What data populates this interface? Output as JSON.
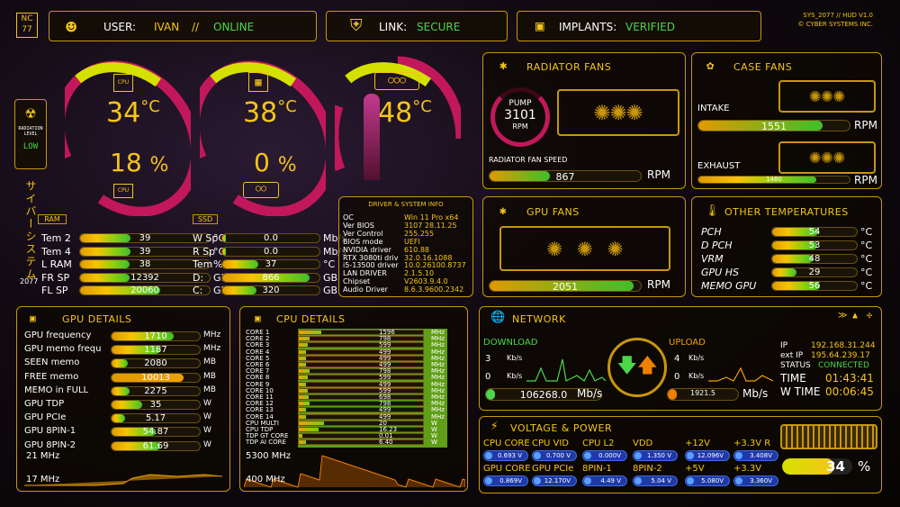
{
  "header": {
    "logo": "NC\n77",
    "user_label": "USER:",
    "user_name": "IVAN",
    "user_sep": "//",
    "user_status": "ONLINE",
    "link_label": "LINK:",
    "link_value": "SECURE",
    "implants_label": "IMPLANTS:",
    "implants_value": "VERIFIED",
    "sys_line1": "SYS_2077 // HUD V1.0",
    "sys_line2": "© CYBER SYSTEMS INC."
  },
  "radiation": {
    "label1": "RADIATION",
    "label2": "LEVEL",
    "value": "LOW"
  },
  "side_text": "サイバーシステム",
  "side_year": "2077",
  "gauges": [
    {
      "temp": "34",
      "unit": "°C",
      "load": "18",
      "load_unit": "%",
      "chip": "CPU",
      "level": 0.18
    },
    {
      "temp": "38",
      "unit": "°C",
      "load": "0",
      "load_unit": "%",
      "chip": "GPU",
      "level": 0.0
    },
    {
      "temp": "48",
      "unit": "°C",
      "chip": "GPU",
      "level": 0.48
    }
  ],
  "ram_tag": "RAM",
  "ssd_tag": "SSD",
  "ram_rows": [
    {
      "label": "Tem 2",
      "value": "39",
      "unit": "°C",
      "level": 0.39
    },
    {
      "label": "Tem 4",
      "value": "39",
      "unit": "°C",
      "level": 0.39
    },
    {
      "label": "L RAM",
      "value": "38",
      "unit": "%",
      "level": 0.38
    },
    {
      "label": "FR SP",
      "value": "12392",
      "unit": "GB",
      "level": 0.38
    },
    {
      "label": "FL SP",
      "value": "20060",
      "unit": "GB",
      "level": 0.62
    }
  ],
  "ssd_rows": [
    {
      "label": "W Sp",
      "value": "0.0",
      "unit": "Mb/s",
      "level": 0.0
    },
    {
      "label": "R Sp",
      "value": "0.0",
      "unit": "Mb/s",
      "level": 0.0
    },
    {
      "label": "Tem",
      "value": "37",
      "unit": "°C",
      "level": 0.37
    },
    {
      "label": "D:",
      "value": "866",
      "unit": "GB",
      "level": 0.9
    },
    {
      "label": "C:",
      "value": "320",
      "unit": "GB",
      "level": 0.35
    }
  ],
  "driver": {
    "title": "DRIVER & SYSTEM INFO",
    "rows": [
      {
        "k": "OC",
        "v": "Win 11 Pro x64"
      },
      {
        "k": "Ver BIOS",
        "v": "3107  28.11.25"
      },
      {
        "k": "Ver Control",
        "v": "255.255"
      },
      {
        "k": "BIOS mode",
        "v": "UEFI"
      },
      {
        "k": "NVIDIA driver",
        "v": "610.88"
      },
      {
        "k": "RTX 3080ti driv",
        "v": "32.0.16.1088"
      },
      {
        "k": "i5-13500 driver",
        "v": "10.0.26100.8737"
      },
      {
        "k": "LAN DRIVER",
        "v": "2.1.5.10"
      },
      {
        "k": "Chipset",
        "v": "V2603.9.4.0"
      },
      {
        "k": "Audio Driver",
        "v": "8.6.3.9600.2342"
      }
    ]
  },
  "gpu_details": {
    "title": "GPU DETAILS",
    "rows": [
      {
        "label": "GPU frequency",
        "value": "1710",
        "unit": "MHz",
        "level": 0.7
      },
      {
        "label": "GPU memo frequ",
        "value": "1187",
        "unit": "MHz",
        "level": 0.55
      },
      {
        "label": "SEEN memo",
        "value": "2080",
        "unit": "MB",
        "level": 0.18
      },
      {
        "label": "FREE memo",
        "value": "10013",
        "unit": "MB",
        "level": 0.82
      },
      {
        "label": "MEMO in FULL",
        "value": "2275",
        "unit": "MB",
        "level": 0.2
      },
      {
        "label": "GPU     TDP",
        "value": "35",
        "unit": "W",
        "level": 0.35
      },
      {
        "label": "GPU    PCIe",
        "value": "5.17",
        "unit": "W",
        "level": 0.15
      },
      {
        "label": "GPU     8PIN-1",
        "value": "54.87",
        "unit": "W",
        "level": 0.5
      },
      {
        "label": "GPU     8PIN-2",
        "value": "61.69",
        "unit": "W",
        "level": 0.55
      }
    ],
    "graph_top": "21 MHz",
    "graph_bottom": "17 MHz"
  },
  "cpu_details": {
    "title": "CPU DETAILS",
    "rows": [
      {
        "label": "CORE 1",
        "value": "1596",
        "unit": "MHz",
        "level": 0.18
      },
      {
        "label": "CORE 2",
        "value": "798",
        "unit": "MHz",
        "level": 0.09
      },
      {
        "label": "CORE 3",
        "value": "599",
        "unit": "MHz",
        "level": 0.07
      },
      {
        "label": "CORE 4",
        "value": "499",
        "unit": "MHz",
        "level": 0.06
      },
      {
        "label": "CORE 5",
        "value": "499",
        "unit": "MHz",
        "level": 0.06
      },
      {
        "label": "CORE 6",
        "value": "499",
        "unit": "MHz",
        "level": 0.06
      },
      {
        "label": "CORE 7",
        "value": "798",
        "unit": "MHz",
        "level": 0.09
      },
      {
        "label": "CORE 8",
        "value": "599",
        "unit": "MHz",
        "level": 0.07
      },
      {
        "label": "CORE 9",
        "value": "499",
        "unit": "MHz",
        "level": 0.06
      },
      {
        "label": "CORE 10",
        "value": "599",
        "unit": "MHz",
        "level": 0.07
      },
      {
        "label": "CORE 11",
        "value": "698",
        "unit": "MHz",
        "level": 0.08
      },
      {
        "label": "CORE 12",
        "value": "798",
        "unit": "MHz",
        "level": 0.09
      },
      {
        "label": "CORE 13",
        "value": "499",
        "unit": "MHz",
        "level": 0.06
      },
      {
        "label": "CORE 14",
        "value": "499",
        "unit": "MHz",
        "level": 0.06
      },
      {
        "label": "CPU MULTI",
        "value": "20",
        "unit": "W",
        "level": 0.2
      },
      {
        "label": "CPU TDP",
        "value": "16.23",
        "unit": "W",
        "level": 0.16
      },
      {
        "label": "TDP GT CORE",
        "value": "0.01",
        "unit": "W",
        "level": 0.0
      },
      {
        "label": "TDP AI CORE",
        "value": "6.40",
        "unit": "W",
        "level": 0.06
      }
    ],
    "graph_top": "5300 MHz",
    "graph_bottom": "400  MHz"
  },
  "radiator": {
    "title": "RADIATOR FANS",
    "pump_label": "PUMP",
    "pump_value": "3101",
    "pump_unit": "RPM",
    "speed_label": "RADIATOR FAN SPEED",
    "speed_value": "867",
    "speed_unit": "RPM",
    "level": 0.4
  },
  "case_fans": {
    "title": "CASE FANS",
    "intake_label": "INTAKE",
    "intake_value": "1551",
    "intake_unit": "RPM",
    "intake_level": 0.82,
    "exhaust_label": "EXHAUST",
    "exhaust_value": "1480",
    "exhaust_unit": "RPM",
    "exhaust_level": 0.78
  },
  "gpu_fans": {
    "title": "GPU FANS",
    "value": "2051",
    "unit": "RPM",
    "level": 0.95
  },
  "other_temps": {
    "title": "OTHER TEMPERATURES",
    "rows": [
      {
        "label": "PCH",
        "value": "54",
        "unit": "°C",
        "level": 0.54
      },
      {
        "label": "D PCH",
        "value": "53",
        "unit": "°C",
        "level": 0.53
      },
      {
        "label": "VRM",
        "value": "48",
        "unit": "°C",
        "level": 0.48
      },
      {
        "label": "GPU HS",
        "value": "29",
        "unit": "°C",
        "level": 0.29
      },
      {
        "label": "MEMO GPU",
        "value": "56",
        "unit": "°C",
        "level": 0.56
      }
    ]
  },
  "network": {
    "title": "NETWORK",
    "download_label": "DOWNLOAD",
    "upload_label": "UPLOAD",
    "dl_axis_top": "3",
    "dl_axis_bottom": "0",
    "ul_axis_top": "4",
    "ul_axis_bottom": "0",
    "axis_unit": "Kb/s",
    "dl_value": "106268.0",
    "dl_unit": "Mb/s",
    "ul_value": "1921.5",
    "ul_unit": "Mb/s",
    "ip_label": "IP",
    "ip_value": "192.168.31.244",
    "ext_label": "ext IP",
    "ext_value": "195.64.239.17",
    "status_label": "STATUS",
    "status_value": "CONNECTED",
    "time_label": "TIME",
    "time_value": "01:43:41",
    "wtime_label": "W TIME",
    "wtime_value": "00:06:45"
  },
  "voltage": {
    "title": "VOLTAGE & POWER",
    "row1": [
      {
        "label": "CPU CORE",
        "value": "0.693 V"
      },
      {
        "label": "CPU VID",
        "value": "0.700 V"
      },
      {
        "label": "CPU L2",
        "value": "0.000V"
      },
      {
        "label": "VDD",
        "value": "1.350 V"
      },
      {
        "label": "+12V",
        "value": "12.096V"
      },
      {
        "label": "+3.3V R",
        "value": "3.408V"
      }
    ],
    "row2": [
      {
        "label": "GPU CORE",
        "value": "0.869V"
      },
      {
        "label": "GPU PCIe",
        "value": "12.170V"
      },
      {
        "label": "8PIN-1",
        "value": "4.49 V"
      },
      {
        "label": "8PIN-2",
        "value": "5.04 V"
      },
      {
        "label": "+5V",
        "value": "5.080V"
      },
      {
        "label": "+3.3V",
        "value": "3.360V"
      }
    ],
    "battery_value": "34",
    "battery_unit": "%",
    "battery_level": 0.34
  },
  "colors": {
    "accent": "#f5c518",
    "ring": "#c2185b",
    "ok": "#4bd64b",
    "panel_border": "#c8960c"
  }
}
